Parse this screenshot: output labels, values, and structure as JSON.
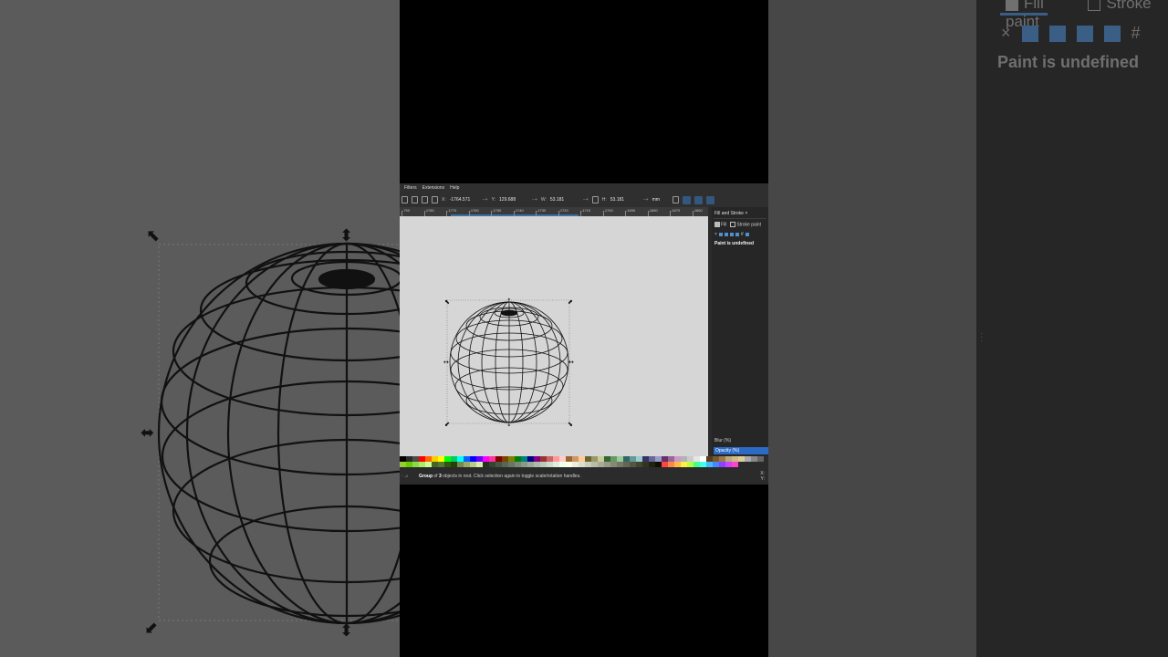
{
  "menu": [
    "Filters",
    "Extensions",
    "Help"
  ],
  "toolbar": {
    "x_label": "X:",
    "x_value": "-1764.571",
    "y_label": "Y:",
    "y_value": "129.688",
    "w_label": "W:",
    "w_value": "53.181",
    "h_label": "H:",
    "h_value": "53.181",
    "unit": "mm",
    "plus_minus": "−+"
  },
  "ruler": [
    "-790",
    "-1780",
    "-1770",
    "-1760",
    "-1750",
    "-1740",
    "-1730",
    "-1720",
    "-1710",
    "-1700",
    "-1690",
    "-1680",
    "-1670",
    "-1660"
  ],
  "panel": {
    "tab_title": "Fill and Stroke",
    "close": "×",
    "fill_tab": "Fill",
    "stroke_paint_tab": "Stroke paint",
    "paint_status": "Paint is undefined",
    "blur_label": "Blur (%)",
    "opacity_label": "Opacity (%)"
  },
  "status": {
    "prefix": "Group",
    "mid": " of ",
    "count": "3",
    "suffix": " objects in root. Click selection again to toggle scale/rotation handles.",
    "x_coord": "X:",
    "y_coord": "Y:"
  },
  "background_panel": {
    "fill_tab": "Fill",
    "stroke_tab": "Stroke paint",
    "close": "×",
    "paint_status": "Paint is undefined"
  },
  "colors": {
    "accent": "#2c6bc5",
    "canvas": "#d6d6d6",
    "panel_bg": "#262626"
  },
  "palette": [
    "#000000",
    "#2b2b2b",
    "#4d4d4d",
    "#ff0000",
    "#ff6600",
    "#ffcc00",
    "#ffff00",
    "#00ff00",
    "#00cc66",
    "#00ffff",
    "#0066ff",
    "#0000ff",
    "#6600ff",
    "#ff00ff",
    "#ff3399",
    "#800000",
    "#804000",
    "#808000",
    "#008000",
    "#008080",
    "#000080",
    "#800080",
    "#993333",
    "#cc6666",
    "#ff9999",
    "#ffcccc",
    "#996633",
    "#cc9966",
    "#ffcc99",
    "#666633",
    "#999966",
    "#cccc99",
    "#336633",
    "#669966",
    "#99cc99",
    "#336666",
    "#669999",
    "#99cccc",
    "#333366",
    "#666699",
    "#9999cc",
    "#663366",
    "#996699",
    "#cc99cc",
    "#b3b3b3",
    "#cccccc",
    "#e6e6e6",
    "#ffffff",
    "#5a3a1a",
    "#7a5a2a",
    "#9a7a4a",
    "#bbaa77",
    "#ccbb88",
    "#ddcc99",
    "#aaaaaa",
    "#888888",
    "#666666",
    "#99cc33",
    "#66cc00",
    "#88dd44",
    "#aaee66",
    "#ccff99",
    "#446622",
    "#557733",
    "#335511",
    "#224400",
    "#778855",
    "#99aa66",
    "#bbcc88",
    "#ddeeaa",
    "#223322",
    "#334433",
    "#445544",
    "#556655",
    "#667766",
    "#778877",
    "#889988",
    "#99aa99",
    "#aabbaa",
    "#bbccbb",
    "#ccddcc",
    "#ddeedd",
    "#eeffee",
    "#ffffee",
    "#eeeedd",
    "#ddddcc",
    "#ccccbb",
    "#bbbbaa",
    "#aaaa99",
    "#999988",
    "#888877",
    "#777766",
    "#666655",
    "#555544",
    "#444433",
    "#333322",
    "#222211",
    "#111100",
    "#ff4444",
    "#ff8844",
    "#ffbb44",
    "#ffee44",
    "#bbff44",
    "#44ff88",
    "#44ffee",
    "#44bbff",
    "#4488ff",
    "#8844ff",
    "#cc44ff",
    "#ff44cc"
  ]
}
